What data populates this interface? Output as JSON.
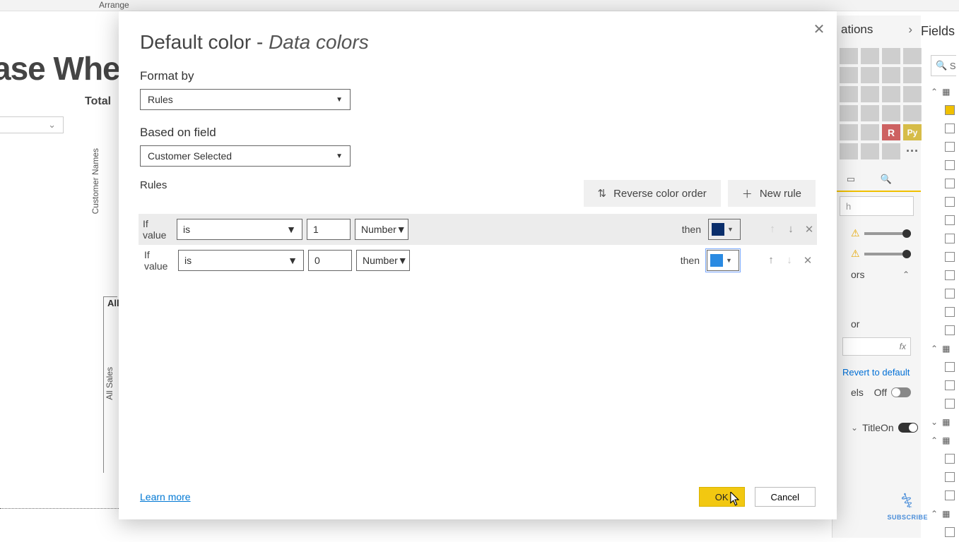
{
  "ribbon": {
    "arrange": "Arrange"
  },
  "background": {
    "title_fragment": "ase Wher",
    "total": "Total",
    "customer_names": "Customer Names",
    "all_sales": "All Sales",
    "all": "All"
  },
  "viz_panel": {
    "title": "ations",
    "search_placeholder": "h",
    "r_label": "R",
    "py_label": "Py",
    "dots": "···",
    "colors_item": "ors",
    "color_item": "or",
    "fx": "fx",
    "revert": "Revert to default",
    "labels_item": "els",
    "labels_state": "Off",
    "title_item": "Title",
    "title_state": "On"
  },
  "fields_panel": {
    "title": "Fields",
    "search_fragment": "S"
  },
  "dialog": {
    "title_prefix": "Default color - ",
    "title_em": "Data colors",
    "format_by_label": "Format by",
    "format_by_value": "Rules",
    "based_on_label": "Based on field",
    "based_on_value": "Customer Selected",
    "rules_label": "Rules",
    "reverse_btn": "Reverse color order",
    "new_rule_btn": "New rule",
    "if_value": "If value",
    "then": "then",
    "op_is": "is",
    "type_number": "Number",
    "rules": [
      {
        "value": "1",
        "color": "#0a2e6b"
      },
      {
        "value": "0",
        "color": "#2a8ae2"
      }
    ],
    "learn_more": "Learn more",
    "ok": "OK",
    "cancel": "Cancel"
  },
  "subscribe": {
    "text": "SUBSCRIBE"
  }
}
